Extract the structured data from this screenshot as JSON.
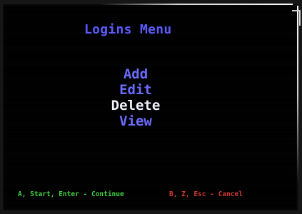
{
  "title": "Logins Menu",
  "menu": {
    "items": [
      {
        "label": "Add",
        "selected": false
      },
      {
        "label": "Edit",
        "selected": false
      },
      {
        "label": "Delete",
        "selected": true
      },
      {
        "label": "View",
        "selected": false
      }
    ]
  },
  "footer": {
    "continue_hint": "A, Start, Enter - Continue",
    "cancel_hint": "B, Z, Esc - Cancel"
  },
  "colors": {
    "background": "#000000",
    "title": "#5a5aff",
    "menu_item": "#6b6bff",
    "menu_selected": "#f2f2ff",
    "continue": "#3fd23f",
    "cancel": "#d23a32"
  }
}
